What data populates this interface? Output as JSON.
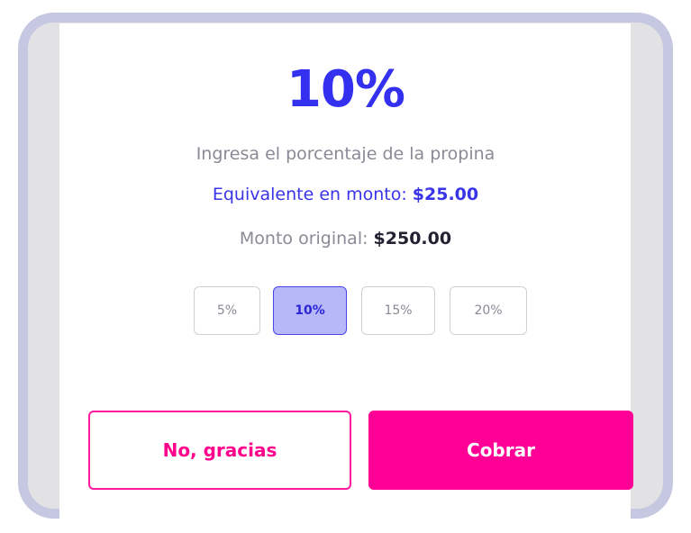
{
  "tip": {
    "percent_display": "10%",
    "instruction": "Ingresa el porcentaje de la propina",
    "equivalent_label": "Equivalente en monto: ",
    "equivalent_value": "$25.00",
    "original_label": "Monto original: ",
    "original_value": "$250.00"
  },
  "presets": [
    {
      "label": "5%",
      "selected": false
    },
    {
      "label": "10%",
      "selected": true
    },
    {
      "label": "15%",
      "selected": false
    },
    {
      "label": "20%",
      "selected": false
    }
  ],
  "actions": {
    "decline_label": "No, gracias",
    "charge_label": "Cobrar"
  },
  "colors": {
    "accent_blue": "#3330f0",
    "accent_pink": "#ff0097",
    "frame": "#c6c7e0"
  }
}
